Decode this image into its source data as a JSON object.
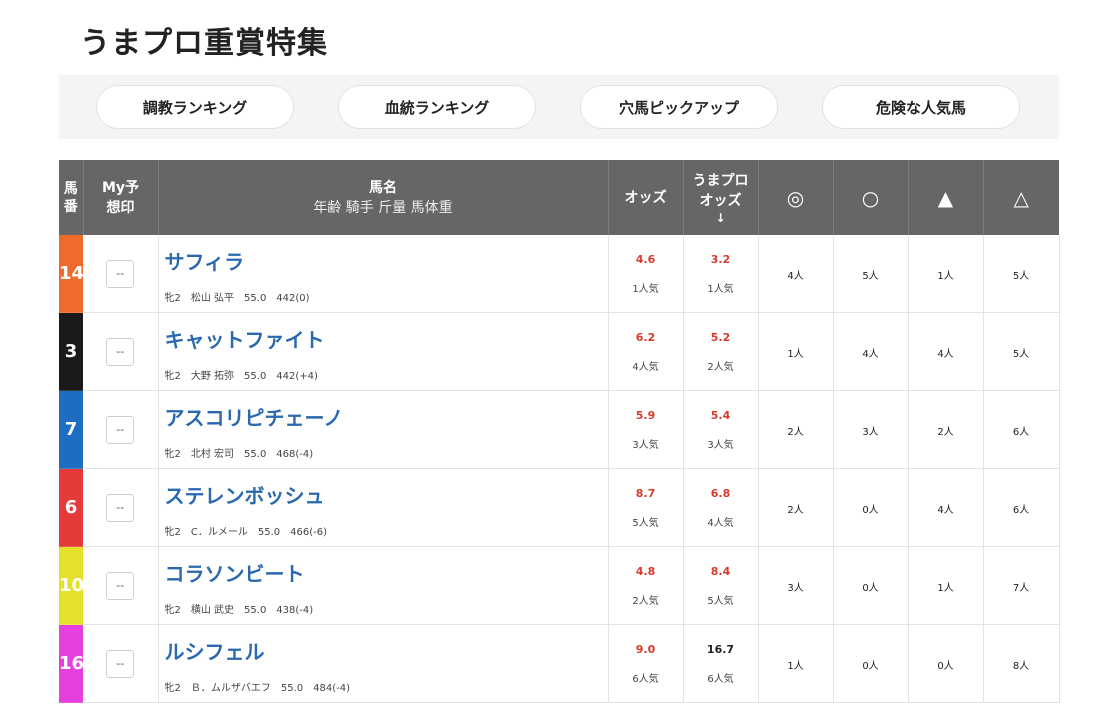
{
  "page_title": "うまプロ重賞特集",
  "tabs": [
    {
      "label": "調教ランキング"
    },
    {
      "label": "血統ランキング"
    },
    {
      "label": "穴馬ピックアップ"
    },
    {
      "label": "危険な人気馬"
    }
  ],
  "table": {
    "headers": {
      "num": "馬番",
      "my": "My予想印",
      "name": "馬名",
      "name_sub": "年齢 騎手 斤量 馬体重",
      "odds": "オッズ",
      "umapro_odds": "うまプロオッズ",
      "umapro_sort": "↓",
      "mark1": "◎",
      "mark2": "○",
      "mark3": "▲",
      "mark4": "△"
    },
    "rows": [
      {
        "num": "14",
        "color": "#f06a2b",
        "my": "--",
        "name": "サフィラ",
        "info": "牝2　松山 弘平　55.0　442(0)",
        "odds": "4.6",
        "odds_pop": "1人気",
        "umapro_odds": "3.2",
        "umapro_pop": "1人気",
        "m1": "4人",
        "m2": "5人",
        "m3": "1人",
        "m4": "5人"
      },
      {
        "num": "3",
        "color": "#1a1a1a",
        "my": "--",
        "name": "キャットファイト",
        "info": "牝2　大野 拓弥　55.0　442(+4)",
        "odds": "6.2",
        "odds_pop": "4人気",
        "umapro_odds": "5.2",
        "umapro_pop": "2人気",
        "m1": "1人",
        "m2": "4人",
        "m3": "4人",
        "m4": "5人"
      },
      {
        "num": "7",
        "color": "#1e6dc2",
        "my": "--",
        "name": "アスコリピチェーノ",
        "info": "牝2　北村 宏司　55.0　468(-4)",
        "odds": "5.9",
        "odds_pop": "3人気",
        "umapro_odds": "5.4",
        "umapro_pop": "3人気",
        "m1": "2人",
        "m2": "3人",
        "m3": "2人",
        "m4": "6人"
      },
      {
        "num": "6",
        "color": "#e53a3a",
        "my": "--",
        "name": "ステレンボッシュ",
        "info": "牝2　C．ルメール　55.0　466(-6)",
        "odds": "8.7",
        "odds_pop": "5人気",
        "umapro_odds": "6.8",
        "umapro_pop": "4人気",
        "m1": "2人",
        "m2": "0人",
        "m3": "4人",
        "m4": "6人"
      },
      {
        "num": "10",
        "color": "#e4e12d",
        "my": "--",
        "name": "コラソンビート",
        "info": "牝2　横山 武史　55.0　438(-4)",
        "odds": "4.8",
        "odds_pop": "2人気",
        "umapro_odds": "8.4",
        "umapro_pop": "5人気",
        "m1": "3人",
        "m2": "0人",
        "m3": "1人",
        "m4": "7人"
      },
      {
        "num": "16",
        "color": "#e63fe0",
        "my": "--",
        "name": "ルシフェル",
        "info": "牝2　Ｂ．ムルザバエフ　55.0　484(-4)",
        "odds": "9.0",
        "odds_pop": "6人気",
        "umapro_odds": "16.7",
        "umapro_pop": "6人気",
        "umapro_dark": true,
        "m1": "1人",
        "m2": "0人",
        "m3": "0人",
        "m4": "8人"
      }
    ]
  }
}
